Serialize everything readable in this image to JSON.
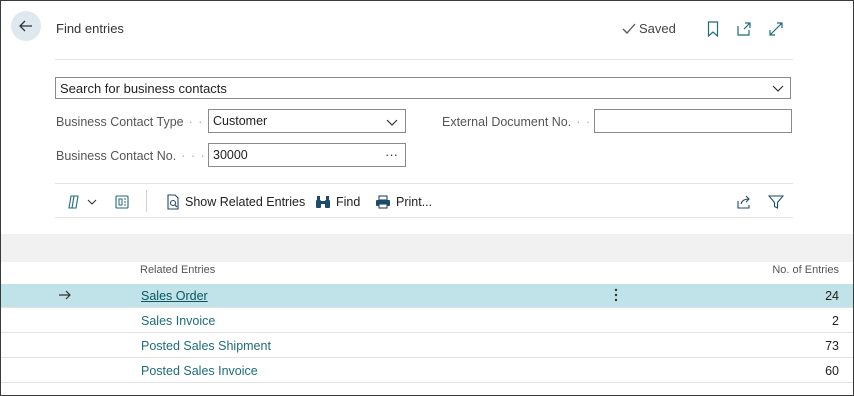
{
  "header": {
    "title": "Find entries",
    "saved_label": "Saved",
    "icons": [
      "back-arrow-icon",
      "check-icon",
      "bookmark-icon",
      "open-new-window-icon",
      "expand-icon"
    ]
  },
  "search": {
    "value": "Search for business contacts"
  },
  "fields": {
    "business_contact_type": {
      "label": "Business Contact Type",
      "value": "Customer"
    },
    "business_contact_no": {
      "label": "Business Contact No.",
      "value": "30000"
    },
    "external_document_no": {
      "label": "External Document No.",
      "value": ""
    }
  },
  "toolbar": {
    "show_related_entries": "Show Related Entries",
    "find": "Find",
    "print": "Print..."
  },
  "list": {
    "columns": {
      "related_entries": "Related Entries",
      "no_of_entries": "No. of Entries"
    },
    "rows": [
      {
        "name": "Sales Order",
        "count": "24",
        "selected": true
      },
      {
        "name": "Sales Invoice",
        "count": "2",
        "selected": false
      },
      {
        "name": "Posted Sales Shipment",
        "count": "73",
        "selected": false
      },
      {
        "name": "Posted Sales Invoice",
        "count": "60",
        "selected": false
      }
    ]
  },
  "colors": {
    "accent_link": "#1f6c78",
    "selected_row": "#bfe3e8",
    "back_button_bg": "#dde9ef"
  }
}
